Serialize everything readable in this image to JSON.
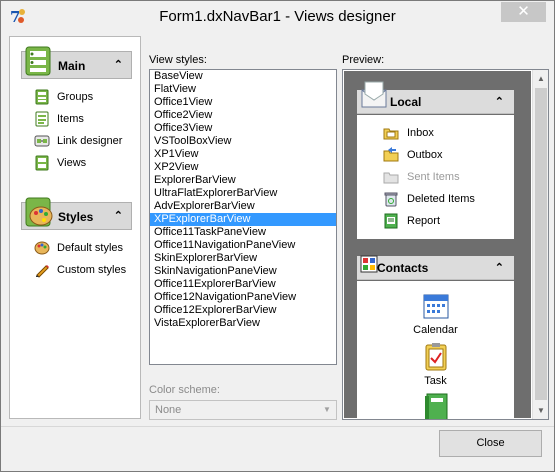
{
  "window": {
    "title": "Form1.dxNavBar1  - Views designer",
    "close_glyph": "✕"
  },
  "left_nav": {
    "groups": [
      {
        "title": "Main",
        "icon": "main-group-icon",
        "chevron": "⌃",
        "items": [
          {
            "label": "Groups",
            "icon": "groups-icon"
          },
          {
            "label": "Items",
            "icon": "items-icon"
          },
          {
            "label": "Link designer",
            "icon": "link-designer-icon"
          },
          {
            "label": "Views",
            "icon": "views-icon"
          }
        ]
      },
      {
        "title": "Styles",
        "icon": "palette-icon",
        "chevron": "⌃",
        "items": [
          {
            "label": "Default styles",
            "icon": "palette-small-icon"
          },
          {
            "label": "Custom styles",
            "icon": "pencil-icon"
          }
        ]
      }
    ]
  },
  "view_styles": {
    "label": "View styles:",
    "items": [
      "BaseView",
      "FlatView",
      "Office1View",
      "Office2View",
      "Office3View",
      "VSToolBoxView",
      "XP1View",
      "XP2View",
      "ExplorerBarView",
      "UltraFlatExplorerBarView",
      "AdvExplorerBarView",
      "XPExplorerBarView",
      "Office11TaskPaneView",
      "Office11NavigationPaneView",
      "SkinExplorerBarView",
      "SkinNavigationPaneView",
      "Office11ExplorerBarView",
      "Office12NavigationPaneView",
      "Office12ExplorerBarView",
      "VistaExplorerBarView"
    ],
    "selected": "XPExplorerBarView"
  },
  "color_scheme": {
    "label": "Color scheme:",
    "value": "None"
  },
  "preview": {
    "label": "Preview:",
    "groups": [
      {
        "title": "Local",
        "icon": "mail-envelope-icon",
        "chevron": "⌃",
        "items": [
          {
            "label": "Inbox",
            "icon": "inbox-folder-icon",
            "enabled": true
          },
          {
            "label": "Outbox",
            "icon": "outbox-folder-icon",
            "enabled": true
          },
          {
            "label": "Sent Items",
            "icon": "sent-items-icon",
            "enabled": false
          },
          {
            "label": "Deleted Items",
            "icon": "recycle-bin-icon",
            "enabled": true
          },
          {
            "label": "Report",
            "icon": "report-icon",
            "enabled": true
          }
        ]
      },
      {
        "title": "Contacts",
        "icon": "contacts-icon",
        "chevron": "⌃",
        "items": [
          {
            "label": "Calendar",
            "icon": "calendar-icon"
          },
          {
            "label": "Task",
            "icon": "task-icon"
          },
          {
            "label": "",
            "icon": "notebook-icon"
          }
        ]
      }
    ]
  },
  "buttons": {
    "close": "Close"
  },
  "colors": {
    "selection": "#3399ff",
    "preview_background": "#6e6e6e",
    "group_header": "#dcdcdc"
  }
}
